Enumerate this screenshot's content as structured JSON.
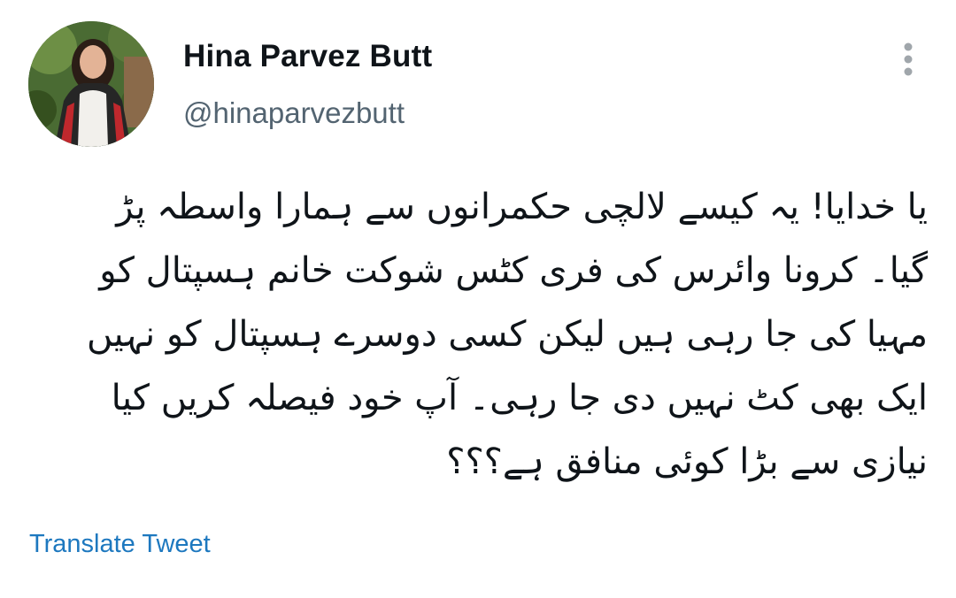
{
  "author": {
    "display_name": "Hina Parvez Butt",
    "handle": "@hinaparvezbutt",
    "avatar_icon": "profile-photo"
  },
  "more_icon": "vertical-ellipsis-icon",
  "tweet": {
    "lines": [
      "یا خدایا! یہ کیسے لالچی حکمرانوں سے ہمارا واسطہ پڑ",
      "گیا۔ کرونا وائرس کی فری کٹس شوکت خانم ہسپتال کو",
      "مہیا کی جا رہی ہیں لیکن کسی دوسرے ہسپتال کو نہیں",
      "ایک بھی کٹ نہیں دی جا رہی۔ آپ خود فیصلہ کریں کیا",
      "نیازی سے بڑا کوئی منافق ہے؟؟؟"
    ]
  },
  "translate_label": "Translate Tweet",
  "colors": {
    "text": "#0f1419",
    "secondary": "#536471",
    "link": "#1d78bf",
    "icon": "#a0a6ab"
  }
}
